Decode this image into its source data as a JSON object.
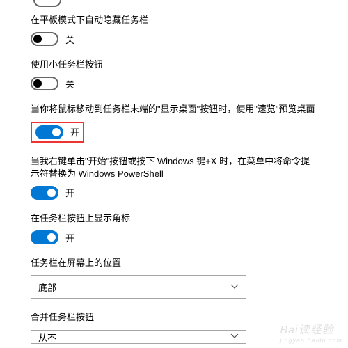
{
  "settings": {
    "autohide_tablet": {
      "label": "在平板模式下自动隐藏任务栏",
      "state_text": "关",
      "on": false
    },
    "small_buttons": {
      "label": "使用小任务栏按钮",
      "state_text": "关",
      "on": false
    },
    "peek_desktop": {
      "label": "当你将鼠标移动到任务栏末端的\"显示桌面\"按钮时，使用\"速览\"预览桌面",
      "state_text": "开",
      "on": true
    },
    "powershell_replace": {
      "label": "当我右键单击\"开始\"按钮或按下 Windows 键+X 时，在菜单中将命令提示符替换为 Windows PowerShell",
      "state_text": "开",
      "on": true
    },
    "show_badges": {
      "label": "在任务栏按钮上显示角标",
      "state_text": "开",
      "on": true
    },
    "taskbar_location": {
      "label": "任务栏在屏幕上的位置",
      "value": "底部"
    },
    "combine_buttons": {
      "label": "合并任务栏按钮",
      "value": "从不"
    }
  },
  "watermark": {
    "main": "Bai读经验",
    "sub": "jingyan.baidu.com"
  }
}
